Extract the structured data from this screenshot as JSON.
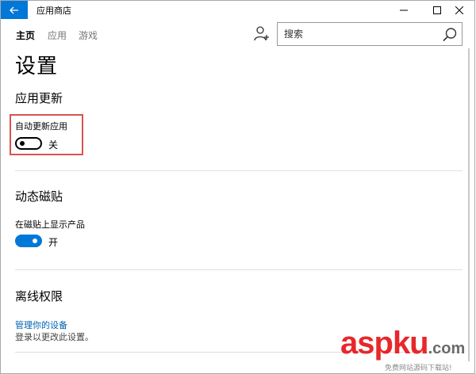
{
  "window": {
    "title": "应用商店",
    "controls": [
      "minimize-icon",
      "maximize-icon",
      "close-icon"
    ],
    "accent_color": "#0078d7"
  },
  "nav": {
    "tabs": [
      "主页",
      "应用",
      "游戏"
    ],
    "active_tab": "主页"
  },
  "search": {
    "placeholder": "搜索",
    "value": ""
  },
  "page": {
    "title": "设置"
  },
  "sections": {
    "app_updates": {
      "title": "应用更新",
      "setting_label": "自动更新应用",
      "toggle_on": false,
      "toggle_state_label": "关"
    },
    "live_tile": {
      "title": "动态磁贴",
      "setting_label": "在磁贴上显示产品",
      "toggle_on": true,
      "toggle_state_label": "开"
    },
    "offline_permissions": {
      "title": "离线权限",
      "link_text": "管理你的设备",
      "description": "登录以更改此设置。"
    }
  },
  "watermark": {
    "brand": "asp",
    "brand_tail": "ku",
    "domain_suffix": ".com",
    "tagline": "免费网站源码下载站!"
  }
}
